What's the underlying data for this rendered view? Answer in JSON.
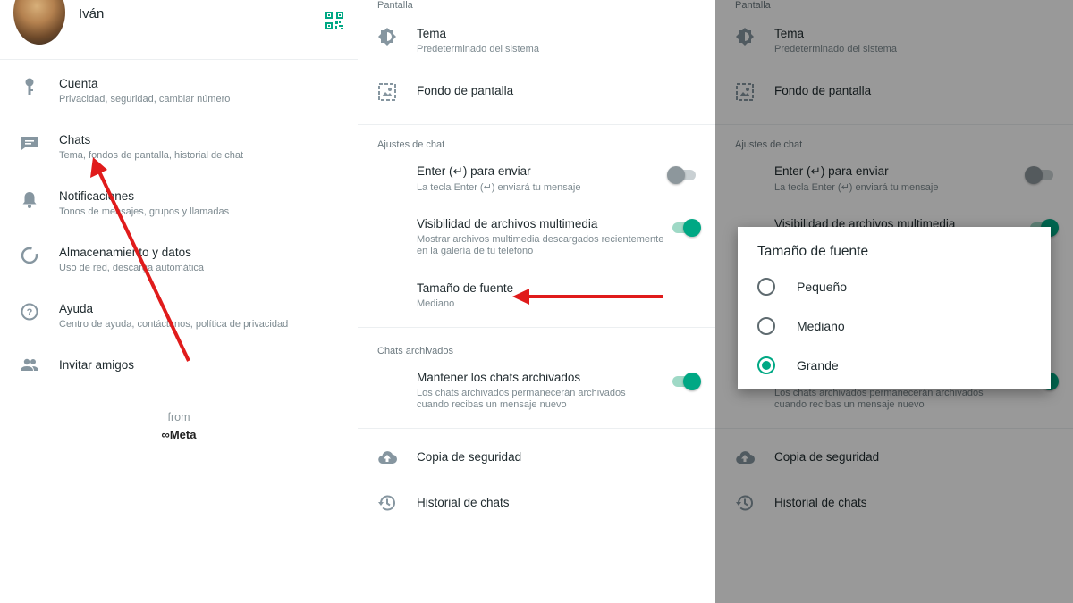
{
  "profile": {
    "name": "Iván"
  },
  "settings_menu": [
    {
      "title": "Cuenta",
      "subtitle": "Privacidad, seguridad, cambiar número",
      "icon": "key-icon"
    },
    {
      "title": "Chats",
      "subtitle": "Tema, fondos de pantalla, historial de chat",
      "icon": "chat-icon"
    },
    {
      "title": "Notificaciones",
      "subtitle": "Tonos de mensajes, grupos y llamadas",
      "icon": "bell-icon"
    },
    {
      "title": "Almacenamiento y datos",
      "subtitle": "Uso de red, descarga automática",
      "icon": "data-usage-icon"
    },
    {
      "title": "Ayuda",
      "subtitle": "Centro de ayuda, contáctanos, política de privacidad",
      "icon": "help-icon"
    },
    {
      "title": "Invitar amigos",
      "subtitle": "",
      "icon": "people-icon"
    }
  ],
  "footer": {
    "from": "from",
    "brand": "∞Meta"
  },
  "chat_settings": {
    "section_display": "Pantalla",
    "theme": {
      "title": "Tema",
      "subtitle": "Predeterminado del sistema"
    },
    "wallpaper": {
      "title": "Fondo de pantalla"
    },
    "section_chat": "Ajustes de chat",
    "enter_send": {
      "title": "Enter (↵) para enviar",
      "subtitle": "La tecla Enter (↵) enviará tu mensaje",
      "enabled": false
    },
    "media_visibility": {
      "title": "Visibilidad de archivos multimedia",
      "subtitle": "Mostrar archivos multimedia descargados recientemente en la galería de tu teléfono",
      "enabled": true
    },
    "font_size": {
      "title": "Tamaño de fuente",
      "subtitle": "Mediano"
    },
    "section_archived": "Chats archivados",
    "keep_archived": {
      "title": "Mantener los chats archivados",
      "subtitle": "Los chats archivados permanecerán archivados cuando recibas un mensaje nuevo",
      "enabled": true
    },
    "backup": {
      "title": "Copia de seguridad"
    },
    "history": {
      "title": "Historial de chats"
    }
  },
  "font_dialog": {
    "title": "Tamaño de fuente",
    "options": [
      {
        "label": "Pequeño",
        "selected": false
      },
      {
        "label": "Mediano",
        "selected": false
      },
      {
        "label": "Grande",
        "selected": true
      }
    ]
  },
  "colors": {
    "accent": "#00a884",
    "annotation_arrow": "#e01b1b",
    "icon": "#8696a0"
  }
}
